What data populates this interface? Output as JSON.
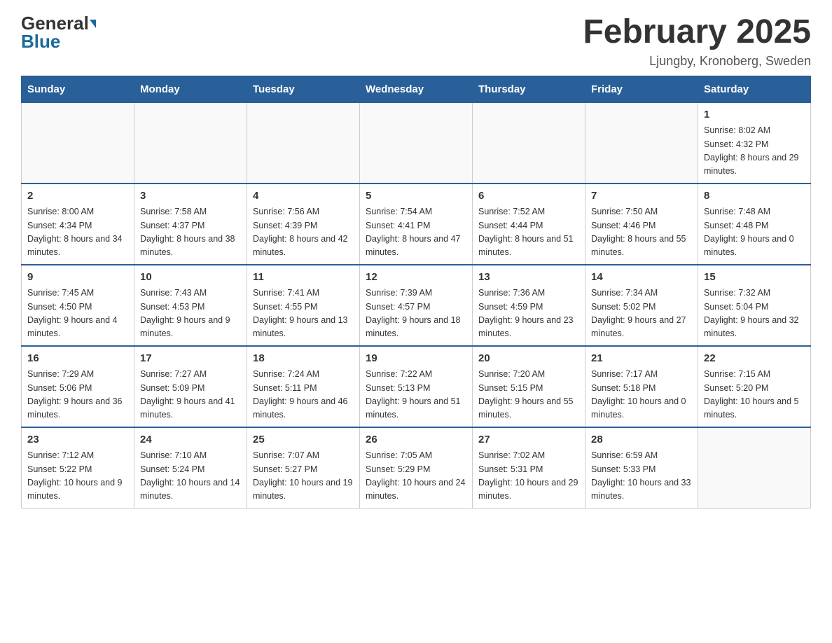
{
  "header": {
    "logo_general": "General",
    "logo_blue": "Blue",
    "title": "February 2025",
    "location": "Ljungby, Kronoberg, Sweden"
  },
  "weekdays": [
    "Sunday",
    "Monday",
    "Tuesday",
    "Wednesday",
    "Thursday",
    "Friday",
    "Saturday"
  ],
  "weeks": [
    [
      {
        "day": "",
        "info": ""
      },
      {
        "day": "",
        "info": ""
      },
      {
        "day": "",
        "info": ""
      },
      {
        "day": "",
        "info": ""
      },
      {
        "day": "",
        "info": ""
      },
      {
        "day": "",
        "info": ""
      },
      {
        "day": "1",
        "info": "Sunrise: 8:02 AM\nSunset: 4:32 PM\nDaylight: 8 hours and 29 minutes."
      }
    ],
    [
      {
        "day": "2",
        "info": "Sunrise: 8:00 AM\nSunset: 4:34 PM\nDaylight: 8 hours and 34 minutes."
      },
      {
        "day": "3",
        "info": "Sunrise: 7:58 AM\nSunset: 4:37 PM\nDaylight: 8 hours and 38 minutes."
      },
      {
        "day": "4",
        "info": "Sunrise: 7:56 AM\nSunset: 4:39 PM\nDaylight: 8 hours and 42 minutes."
      },
      {
        "day": "5",
        "info": "Sunrise: 7:54 AM\nSunset: 4:41 PM\nDaylight: 8 hours and 47 minutes."
      },
      {
        "day": "6",
        "info": "Sunrise: 7:52 AM\nSunset: 4:44 PM\nDaylight: 8 hours and 51 minutes."
      },
      {
        "day": "7",
        "info": "Sunrise: 7:50 AM\nSunset: 4:46 PM\nDaylight: 8 hours and 55 minutes."
      },
      {
        "day": "8",
        "info": "Sunrise: 7:48 AM\nSunset: 4:48 PM\nDaylight: 9 hours and 0 minutes."
      }
    ],
    [
      {
        "day": "9",
        "info": "Sunrise: 7:45 AM\nSunset: 4:50 PM\nDaylight: 9 hours and 4 minutes."
      },
      {
        "day": "10",
        "info": "Sunrise: 7:43 AM\nSunset: 4:53 PM\nDaylight: 9 hours and 9 minutes."
      },
      {
        "day": "11",
        "info": "Sunrise: 7:41 AM\nSunset: 4:55 PM\nDaylight: 9 hours and 13 minutes."
      },
      {
        "day": "12",
        "info": "Sunrise: 7:39 AM\nSunset: 4:57 PM\nDaylight: 9 hours and 18 minutes."
      },
      {
        "day": "13",
        "info": "Sunrise: 7:36 AM\nSunset: 4:59 PM\nDaylight: 9 hours and 23 minutes."
      },
      {
        "day": "14",
        "info": "Sunrise: 7:34 AM\nSunset: 5:02 PM\nDaylight: 9 hours and 27 minutes."
      },
      {
        "day": "15",
        "info": "Sunrise: 7:32 AM\nSunset: 5:04 PM\nDaylight: 9 hours and 32 minutes."
      }
    ],
    [
      {
        "day": "16",
        "info": "Sunrise: 7:29 AM\nSunset: 5:06 PM\nDaylight: 9 hours and 36 minutes."
      },
      {
        "day": "17",
        "info": "Sunrise: 7:27 AM\nSunset: 5:09 PM\nDaylight: 9 hours and 41 minutes."
      },
      {
        "day": "18",
        "info": "Sunrise: 7:24 AM\nSunset: 5:11 PM\nDaylight: 9 hours and 46 minutes."
      },
      {
        "day": "19",
        "info": "Sunrise: 7:22 AM\nSunset: 5:13 PM\nDaylight: 9 hours and 51 minutes."
      },
      {
        "day": "20",
        "info": "Sunrise: 7:20 AM\nSunset: 5:15 PM\nDaylight: 9 hours and 55 minutes."
      },
      {
        "day": "21",
        "info": "Sunrise: 7:17 AM\nSunset: 5:18 PM\nDaylight: 10 hours and 0 minutes."
      },
      {
        "day": "22",
        "info": "Sunrise: 7:15 AM\nSunset: 5:20 PM\nDaylight: 10 hours and 5 minutes."
      }
    ],
    [
      {
        "day": "23",
        "info": "Sunrise: 7:12 AM\nSunset: 5:22 PM\nDaylight: 10 hours and 9 minutes."
      },
      {
        "day": "24",
        "info": "Sunrise: 7:10 AM\nSunset: 5:24 PM\nDaylight: 10 hours and 14 minutes."
      },
      {
        "day": "25",
        "info": "Sunrise: 7:07 AM\nSunset: 5:27 PM\nDaylight: 10 hours and 19 minutes."
      },
      {
        "day": "26",
        "info": "Sunrise: 7:05 AM\nSunset: 5:29 PM\nDaylight: 10 hours and 24 minutes."
      },
      {
        "day": "27",
        "info": "Sunrise: 7:02 AM\nSunset: 5:31 PM\nDaylight: 10 hours and 29 minutes."
      },
      {
        "day": "28",
        "info": "Sunrise: 6:59 AM\nSunset: 5:33 PM\nDaylight: 10 hours and 33 minutes."
      },
      {
        "day": "",
        "info": ""
      }
    ]
  ]
}
